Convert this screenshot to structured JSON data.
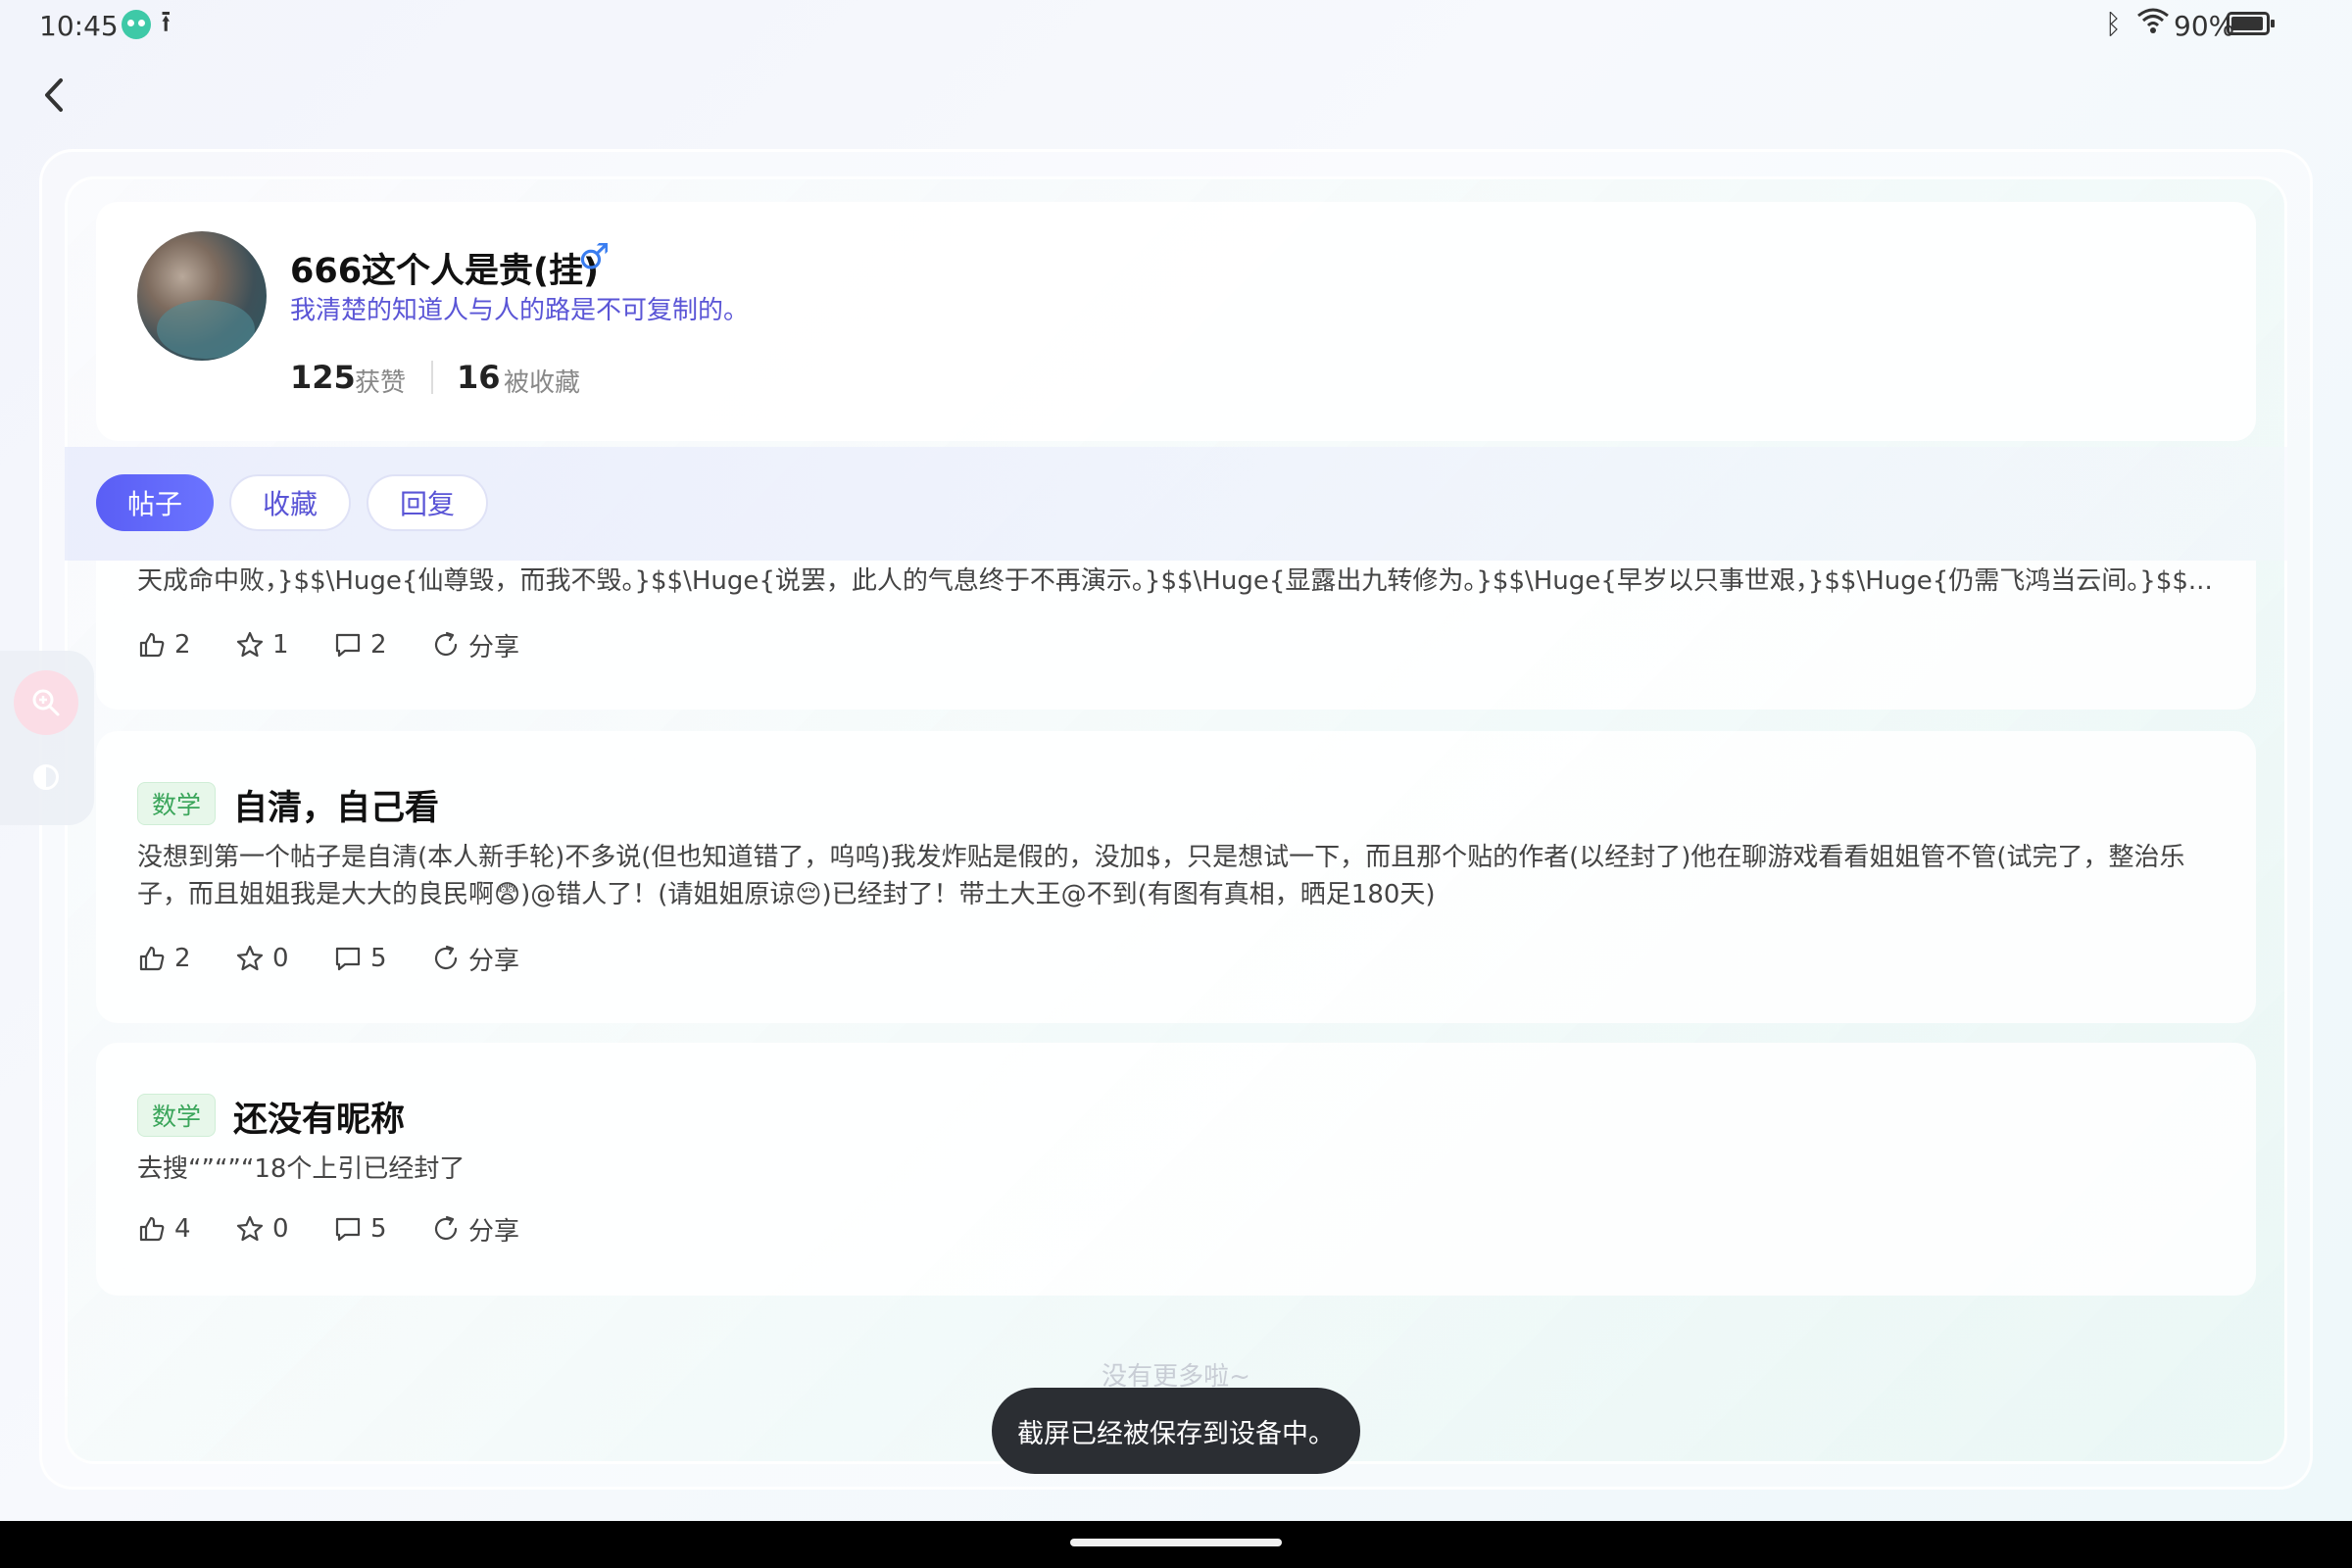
{
  "status_bar": {
    "time": "10:45",
    "battery": "90%",
    "icons": [
      "app-icon",
      "upload-icon",
      "bluetooth-icon",
      "wifi-icon",
      "battery-icon"
    ]
  },
  "profile": {
    "name": "666这个人是贵(挂)",
    "gender_symbol": "♂",
    "bio": "我清楚的知道人与人的路是不可复制的。",
    "likes_count": "125",
    "likes_label": "获赞",
    "favorited_count": "16",
    "favorited_label": "被收藏"
  },
  "tabs": [
    {
      "label": "帖子",
      "active": true
    },
    {
      "label": "收藏",
      "active": false
    },
    {
      "label": "回复",
      "active": false
    }
  ],
  "posts": [
    {
      "body": "天成命中败，}$$\\Huge{仙尊毁，而我不毁。}$$\\Huge{说罢，此人的气息终于不再演示。}$$\\Huge{显露出九转修为。}$$\\Huge{早岁以只事世艰，}$$\\Huge{仍需飞鸿当云间。}$$...",
      "likes": "2",
      "favorites": "1",
      "comments": "2",
      "share_label": "分享"
    },
    {
      "tag": "数学",
      "title": "自清，自己看",
      "body": "没想到第一个帖子是自清(本人新手轮)不多说(但也知道错了，呜呜)我发炸贴是假的，没加$，只是想试一下，而且那个贴的作者(以经封了)他在聊游戏看看姐姐管不管(试完了，整治乐子，而且姐姐我是大大的良民啊😨)@错人了！(请姐姐原谅😔)已经封了！带土大王@不到(有图有真相，晒足180天)",
      "likes": "2",
      "favorites": "0",
      "comments": "5",
      "share_label": "分享"
    },
    {
      "tag": "数学",
      "title": "还没有昵称",
      "body": "去搜“”“”“18个上引已经封了",
      "likes": "4",
      "favorites": "0",
      "comments": "5",
      "share_label": "分享"
    }
  ],
  "list_end_text": "没有更多啦~",
  "toast_text": "截屏已经被保存到设备中。",
  "colors": {
    "accent": "#5a5ef5",
    "tag_green": "#3aa55a",
    "bio_purple": "#5a55d6"
  }
}
